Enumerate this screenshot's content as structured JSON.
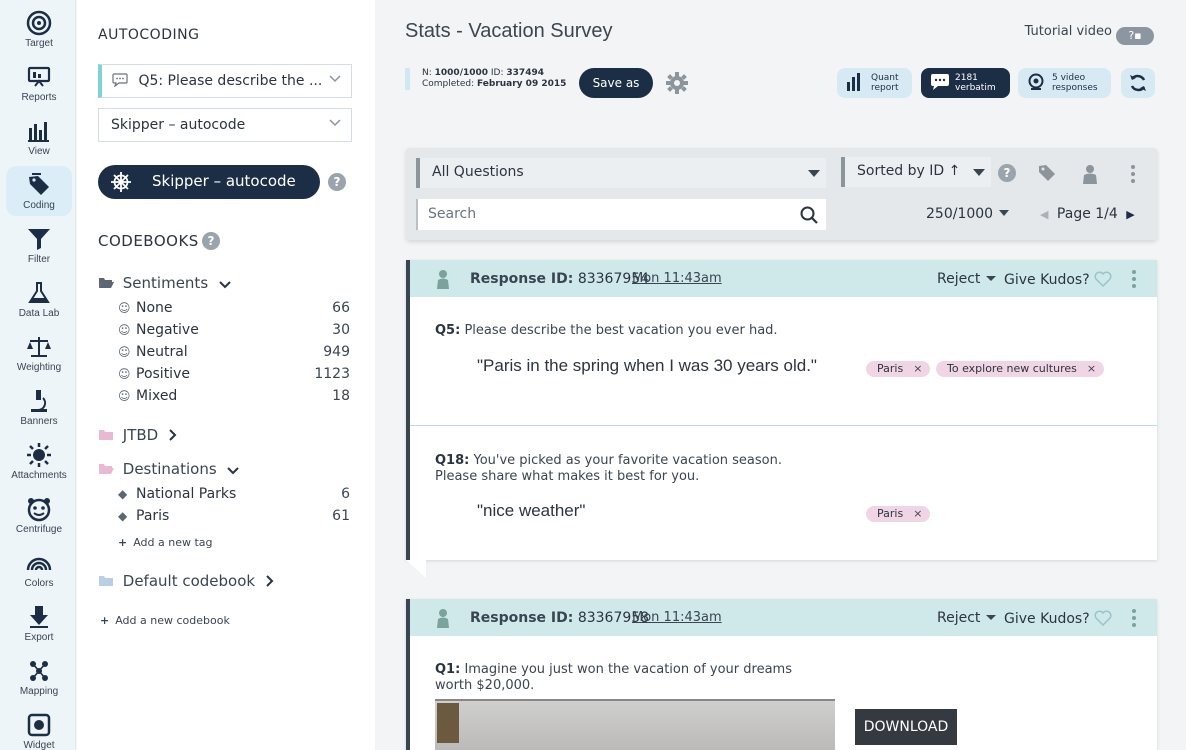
{
  "rail": {
    "items": [
      {
        "label": "Target",
        "icon": "target-icon"
      },
      {
        "label": "Reports",
        "icon": "reports-icon"
      },
      {
        "label": "View",
        "icon": "bar-chart-icon"
      },
      {
        "label": "Coding",
        "icon": "tag-icon",
        "active": true
      },
      {
        "label": "Filter",
        "icon": "filter-icon"
      },
      {
        "label": "Data Lab",
        "icon": "flask-icon"
      },
      {
        "label": "Weighting",
        "icon": "scale-icon"
      },
      {
        "label": "Banners",
        "icon": "microscope-icon"
      },
      {
        "label": "Attachments",
        "icon": "sun-icon"
      },
      {
        "label": "Centrifuge",
        "icon": "face-icon"
      },
      {
        "label": "Colors",
        "icon": "rainbow-icon"
      },
      {
        "label": "Export",
        "icon": "export-icon"
      },
      {
        "label": "Mapping",
        "icon": "mapping-icon"
      },
      {
        "label": "Widget",
        "icon": "widget-icon"
      }
    ]
  },
  "panel": {
    "title": "AUTOCODING",
    "question_select": "Q5: Please describe the ...",
    "autocode_select": "Skipper – autocode",
    "skipper_button": "Skipper – autocode",
    "help": "?",
    "codebooks_title": "CODEBOOKS",
    "sentiments": {
      "label": "Sentiments",
      "tags": [
        {
          "label": "None",
          "count": "66"
        },
        {
          "label": "Negative",
          "count": "30"
        },
        {
          "label": "Neutral",
          "count": "949"
        },
        {
          "label": "Positive",
          "count": "1123"
        },
        {
          "label": "Mixed",
          "count": "18"
        }
      ]
    },
    "jtbd": {
      "label": "JTBD"
    },
    "destinations": {
      "label": "Destinations",
      "tags": [
        {
          "label": "National Parks",
          "count": "6"
        },
        {
          "label": "Paris",
          "count": "61"
        }
      ],
      "add_tag": "Add a new tag"
    },
    "default_codebook": {
      "label": "Default codebook"
    },
    "add_codebook": "Add a new codebook"
  },
  "header": {
    "title": "Stats - Vacation Survey",
    "tutorial": "Tutorial video",
    "info_n_label": "N:",
    "info_n": "1000/1000",
    "info_id_label": "ID:",
    "info_id": "337494",
    "info_completed_label": "Completed:",
    "info_completed": "February 09 2015",
    "save_as": "Save as",
    "quant_line1": "Quant",
    "quant_line2": "report",
    "verbatim_line1": "2181",
    "verbatim_line2": "verbatim",
    "video_line1": "5 video",
    "video_line2": "responses"
  },
  "filters": {
    "questions": "All Questions",
    "sort": "Sorted by ID ↑",
    "search_placeholder": "Search",
    "count": "250/1000",
    "page": "Page 1/4"
  },
  "responses": [
    {
      "id_label": "Response ID:",
      "id": "83367954",
      "time": "Mon 11:43am",
      "reject": "Reject",
      "kudos": "Give Kudos?",
      "answers": [
        {
          "qnum": "Q5:",
          "question": "Please describe the best vacation you ever had.",
          "quote": "\"Paris in the spring when I was 30 years old.\"",
          "chips": [
            "Paris",
            "To explore new cultures"
          ]
        },
        {
          "qnum": "Q18:",
          "question": "You've picked as your favorite vacation season. Please share what makes it best for you.",
          "quote": "\"nice weather\"",
          "chips": [
            "Paris"
          ]
        }
      ]
    },
    {
      "id_label": "Response ID:",
      "id": "83367958",
      "time": "Mon 11:43am",
      "reject": "Reject",
      "kudos": "Give Kudos?",
      "answers": [
        {
          "qnum": "Q1:",
          "question": "Imagine you just won the vacation of your dreams worth $20,000.",
          "download": "DOWNLOAD"
        }
      ]
    }
  ],
  "chip_remove": "×",
  "colors": {
    "navy": "#1c2e45",
    "teal_header": "#cfe8ea",
    "chip": "#f0d6e4",
    "pill": "#d7eaf3"
  }
}
